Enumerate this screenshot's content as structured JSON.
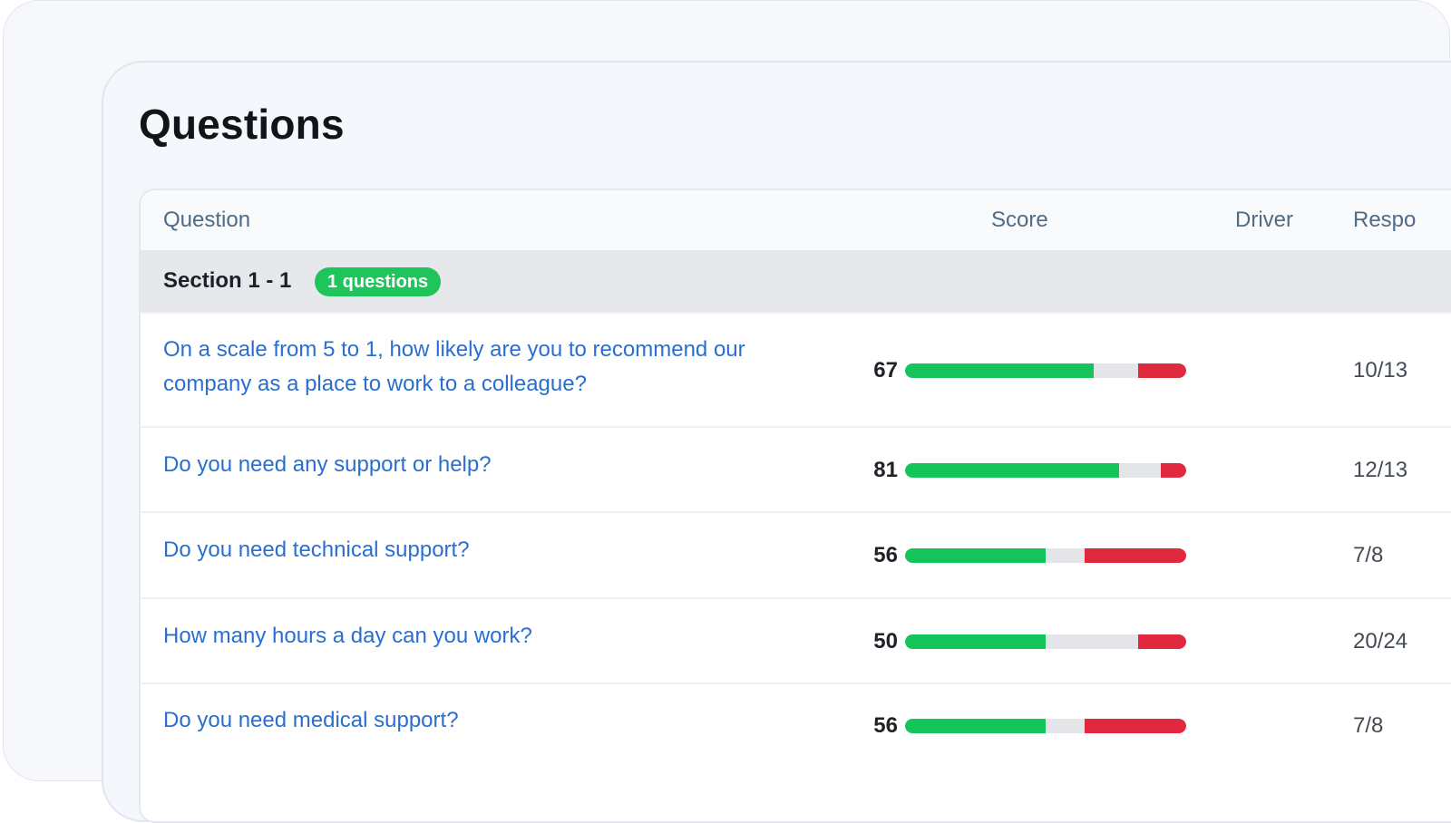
{
  "page": {
    "title": "Questions"
  },
  "table": {
    "headers": {
      "question": "Question",
      "score": "Score",
      "driver": "Driver",
      "responses": "Respo"
    },
    "section": {
      "title": "Section 1 - 1",
      "badge": "1 questions"
    },
    "rows": [
      {
        "question": "On a scale from 5 to 1, how likely are you to recommend our company as a place to work to a colleague?",
        "score": "67",
        "positive_pct": 67,
        "negative_pct": 17,
        "driver": "",
        "responses": "10/13"
      },
      {
        "question": "Do you need any support or help?",
        "score": "81",
        "positive_pct": 76,
        "negative_pct": 9,
        "driver": "",
        "responses": "12/13"
      },
      {
        "question": "Do you need technical support?",
        "score": "56",
        "positive_pct": 50,
        "negative_pct": 36,
        "driver": "",
        "responses": "7/8"
      },
      {
        "question": "How many hours a day can you work?",
        "score": "50",
        "positive_pct": 50,
        "negative_pct": 17,
        "driver": "",
        "responses": "20/24"
      },
      {
        "question": "Do you need medical support?",
        "score": "56",
        "positive_pct": 50,
        "negative_pct": 36,
        "driver": "",
        "responses": "7/8"
      }
    ]
  },
  "colors": {
    "positive": "#14c45a",
    "negative": "#e0293e",
    "neutral": "#e3e5e8",
    "link": "#2a6fd0",
    "badge": "#1fc45b"
  }
}
